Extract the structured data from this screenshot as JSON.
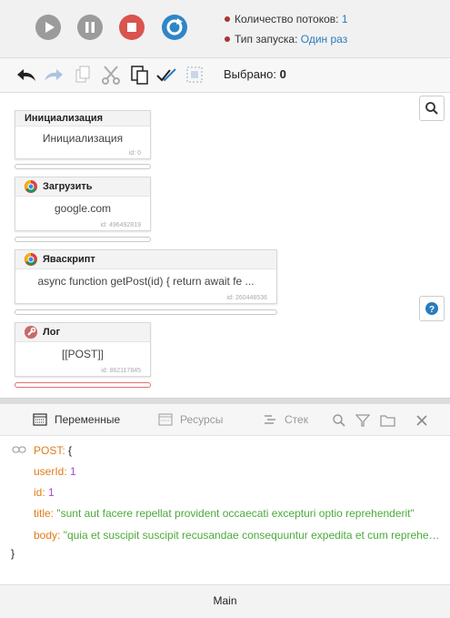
{
  "run": {
    "threads_label": "Количество потоков:",
    "threads_value": "1",
    "launch_label": "Тип запуска:",
    "launch_value": "Один раз"
  },
  "toolbar": {
    "selected_label": "Выбрано:",
    "selected_count": "0"
  },
  "blocks": [
    {
      "title": "Инициализация",
      "body": "Инициализация",
      "id": "id: 0"
    },
    {
      "title": "Загрузить",
      "body": "google.com",
      "id": "id: 496492819"
    },
    {
      "title": "Яваскрипт",
      "body": "async function getPost(id) { return await fe ...",
      "id": "id: 260446536"
    },
    {
      "title": "Лог",
      "body": "[[POST]]",
      "id": "id: 862117845"
    }
  ],
  "panel": {
    "tabs": [
      "Переменные",
      "Ресурсы",
      "Стек"
    ]
  },
  "json_view": {
    "root_key": "POST:",
    "open_brace": "{",
    "close_brace": "}",
    "fields": [
      {
        "key": "userId:",
        "value": "1",
        "type": "number"
      },
      {
        "key": "id:",
        "value": "1",
        "type": "number"
      },
      {
        "key": "title:",
        "value": "\"sunt aut facere repellat provident occaecati excepturi optio reprehenderit\"",
        "type": "string"
      },
      {
        "key": "body:",
        "value": "\"quia et suscipit suscipit recusandae consequuntur expedita et cum reprehe…",
        "type": "string"
      }
    ]
  },
  "footer": {
    "label": "Main"
  }
}
